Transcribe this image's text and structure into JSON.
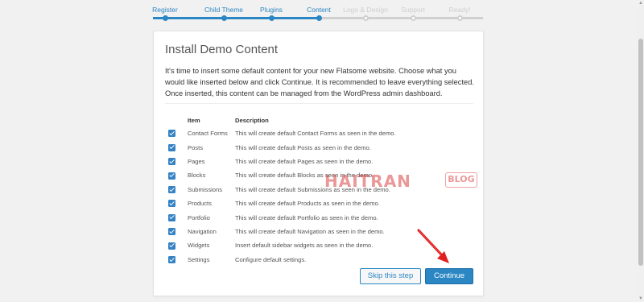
{
  "steps": [
    {
      "label": "Register",
      "state": "done"
    },
    {
      "label": "Child Theme",
      "state": "done"
    },
    {
      "label": "Plugins",
      "state": "done"
    },
    {
      "label": "Content",
      "state": "done"
    },
    {
      "label": "Logo & Design",
      "state": "todo"
    },
    {
      "label": "Support",
      "state": "todo"
    },
    {
      "label": "Ready!",
      "state": "todo"
    }
  ],
  "card": {
    "title": "Install Demo Content",
    "intro": "It's time to insert some default content for your new Flatsome website. Choose what you would like inserted below and click Continue. It is recommended to leave everything selected. Once inserted, this content can be managed from the WordPress admin dashboard.",
    "table": {
      "headers": {
        "item": "Item",
        "description": "Description"
      },
      "rows": [
        {
          "item": "Contact Forms",
          "description": "This will create default Contact Forms as seen in the demo.",
          "checked": true
        },
        {
          "item": "Posts",
          "description": "This will create default Posts as seen in the demo.",
          "checked": true
        },
        {
          "item": "Pages",
          "description": "This will create default Pages as seen in the demo.",
          "checked": true
        },
        {
          "item": "Blocks",
          "description": "This will create default Blocks as seen in the demo.",
          "checked": true
        },
        {
          "item": "Submissions",
          "description": "This will create default Submissions as seen in the demo.",
          "checked": true
        },
        {
          "item": "Products",
          "description": "This will create default Products as seen in the demo.",
          "checked": true
        },
        {
          "item": "Portfolio",
          "description": "This will create default Portfolio as seen in the demo.",
          "checked": true
        },
        {
          "item": "Navigation",
          "description": "This will create default Navigation as seen in the demo.",
          "checked": true
        },
        {
          "item": "Widgets",
          "description": "Insert default sidebar widgets as seen in the demo.",
          "checked": true
        },
        {
          "item": "Settings",
          "description": "Configure default settings.",
          "checked": true
        }
      ]
    },
    "buttons": {
      "skip": "Skip this step",
      "continue": "Continue"
    }
  },
  "watermark": {
    "main": "HAITRAN",
    "badge": "BLOG"
  },
  "colors": {
    "accent": "#2b87c3",
    "arrow": "#e02020",
    "checkbox": "#3582c4"
  }
}
